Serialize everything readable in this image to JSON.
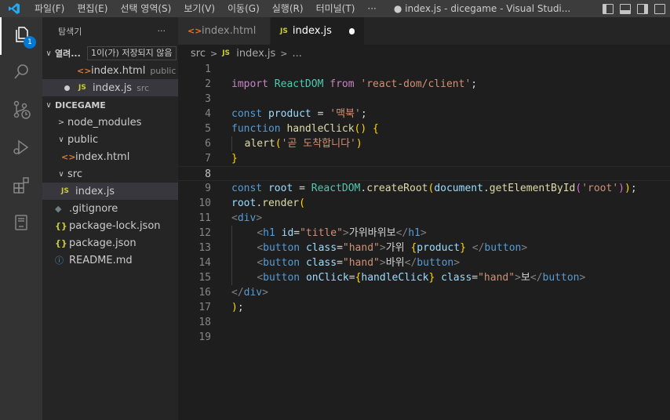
{
  "titlebar": {
    "menu": [
      "파일(F)",
      "편집(E)",
      "선택 영역(S)",
      "보기(V)",
      "이동(G)",
      "실행(R)",
      "터미널(T)",
      "···"
    ],
    "title": "● index.js - dicegame - Visual Studi..."
  },
  "activity": {
    "badge_count": "1"
  },
  "sidebar": {
    "header": "탐색기",
    "more": "···",
    "open_editors": {
      "label": "열려...",
      "tooltip": "1이(가) 저장되지 않음",
      "items": [
        {
          "name": "index.html",
          "desc": "public"
        },
        {
          "name": "index.js",
          "desc": "src"
        }
      ]
    },
    "project": {
      "label": "DICEGAME",
      "tree": [
        {
          "name": "node_modules"
        },
        {
          "name": "public"
        },
        {
          "name": "index.html"
        },
        {
          "name": "src"
        },
        {
          "name": "index.js"
        },
        {
          "name": ".gitignore"
        },
        {
          "name": "package-lock.json"
        },
        {
          "name": "package.json"
        },
        {
          "name": "README.md"
        }
      ]
    }
  },
  "tabs": [
    {
      "label": "index.html",
      "icon": "<>"
    },
    {
      "label": "index.js",
      "icon": "JS",
      "modified": true
    }
  ],
  "breadcrumb": {
    "folder": "src",
    "file": "index.js",
    "symbol": "...",
    "sep": ">"
  },
  "editor": {
    "current_line": 8,
    "line_numbers": [
      "1",
      "2",
      "3",
      "4",
      "5",
      "6",
      "7",
      "8",
      "9",
      "10",
      "11",
      "12",
      "13",
      "14",
      "15",
      "16",
      "17",
      "18",
      "19"
    ],
    "lines": [
      "",
      "import ReactDOM from 'react-dom/client';",
      "",
      "const product = '맥북';",
      "function handleClick() {",
      "  alert('곧 도착합니다')",
      "}",
      "",
      "const root = ReactDOM.createRoot(document.getElementById('root'));",
      "root.render(",
      "<div>",
      "    <h1 id=\"title\">가위바위보</h1>",
      "    <button class=\"hand\">가위 {product} </button>",
      "    <button class=\"hand\">바위</button>",
      "    <button onClick={handleClick} class=\"hand\">보</button>",
      "</div>",
      ");",
      "",
      ""
    ]
  },
  "colors": {
    "accent": "#0078d4",
    "html_icon": "#e37933",
    "js_icon": "#cbcb41"
  }
}
